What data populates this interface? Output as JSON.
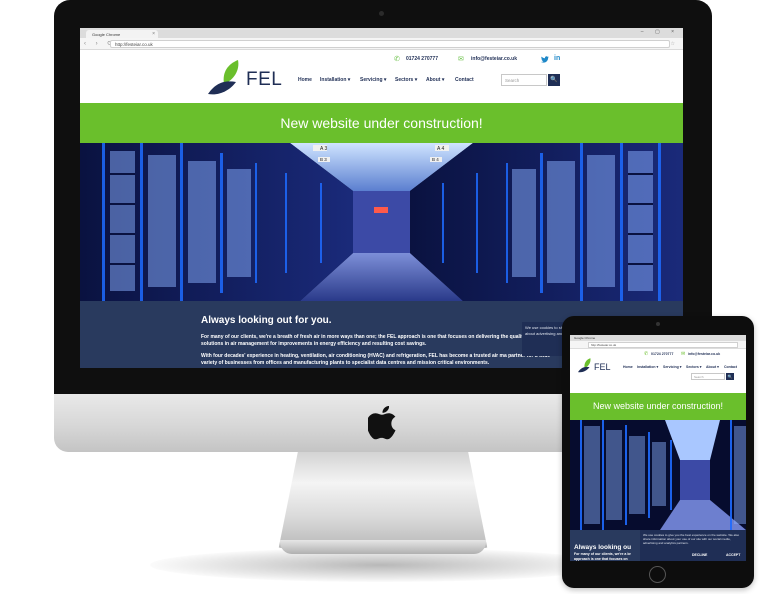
{
  "browser": {
    "tab_title": "Google Chrome",
    "tab_close": "×",
    "window_controls": "– ▢ ×",
    "nav_arrows": "‹ › ⟳",
    "url": "http://festeiar.co.uk",
    "bookmark_icon": "☆"
  },
  "site": {
    "logo_text": "FEL",
    "phone": "01724 270777",
    "email": "info@festeiar.co.uk",
    "social": [
      "twitter-icon",
      "linkedin-icon"
    ],
    "linkedin_label": "in",
    "nav": [
      {
        "label": "Home"
      },
      {
        "label": "Installation ▾"
      },
      {
        "label": "Servicing ▾"
      },
      {
        "label": "Sectors ▾"
      },
      {
        "label": "About ▾"
      },
      {
        "label": "Contact"
      }
    ],
    "search_placeholder": "Search",
    "search_icon": "🔍",
    "banner": "New website under construction!",
    "about_heading": "Always looking out for you.",
    "about_p1": "For many of our clients, we're a breath of fresh air in more ways than one; the FEL approach is one that focuses on delivering the quality solutions in air management for improvements in energy efficiency and resulting cost savings.",
    "about_p2": "With four decades' experience in heating, ventilation, air conditioning (HVAC) and refrigeration, FEL has become a trusted air ma partner for a wide variety of businesses from offices and manufacturing plants to specialist data centres and mission critical environments.",
    "cookie_text": "We use cookies to share information about advertising and an",
    "aisle_labels": [
      "A 3",
      "A 4",
      "B 3",
      "B 4"
    ]
  },
  "ipad": {
    "tab_title": "Google Chrome",
    "url": "http://festeiar.co.uk",
    "about_heading": "Always looking ou",
    "about_text": "For many of our clients, we're a br approach is one that focuses on",
    "cookie_text": "We use cookies to give you the best experience on the website. We also share information about your use of our site with our social media, advertising and analytics partners.",
    "decline": "DECLINE",
    "accept": "ACCEPT"
  },
  "colors": {
    "navy": "#1f2e55",
    "green": "#6abf2c",
    "about_bg": "#293a5e"
  }
}
